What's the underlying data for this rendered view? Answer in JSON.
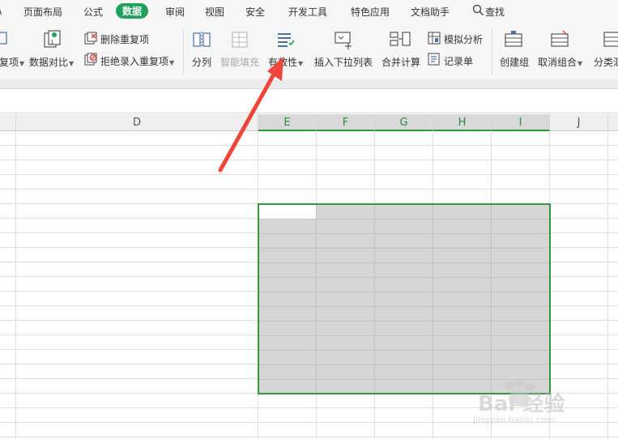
{
  "menu": {
    "partial_first": "\\",
    "page_layout": "页面布局",
    "formula": "公式",
    "data": "数据",
    "review": "审阅",
    "view": "视图",
    "security": "安全",
    "dev_tools": "开发工具",
    "special": "特色应用",
    "doc_assistant": "文档助手",
    "search": "查找"
  },
  "ribbon": {
    "partial_dup": "复项",
    "data_compare": "数据对比",
    "delete_dup": "删除重复项",
    "reject_dup": "拒绝录入重复项",
    "split": "分列",
    "smart_fill": "智能填充",
    "validity": "有效性",
    "insert_dropdown": "插入下拉列表",
    "consolidate": "合并计算",
    "simulate": "模拟分析",
    "record": "记录单",
    "create_group": "创建组",
    "ungroup": "取消组合",
    "subtotal_partial": "分类汇"
  },
  "columns": {
    "d": "D",
    "e": "E",
    "f": "F",
    "g": "G",
    "h": "H",
    "i": "I",
    "j": "J"
  },
  "colors": {
    "accent_green": "#1fa05b",
    "selection_border": "#2f9b3e",
    "annotation_arrow": "#f0453b"
  },
  "watermark": {
    "brand": "Bai 经验",
    "url": "jingyan.baidu.com"
  }
}
